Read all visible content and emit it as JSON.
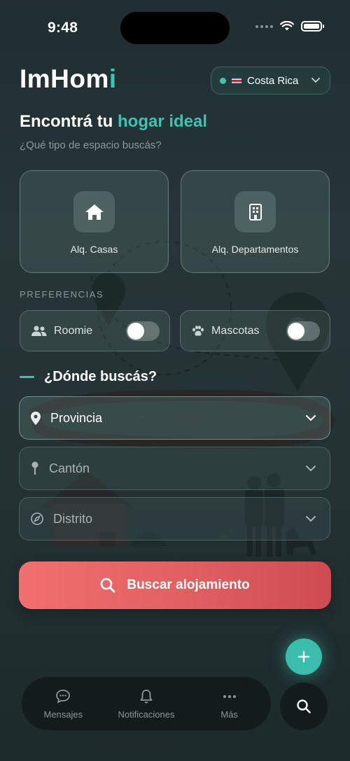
{
  "status_bar": {
    "time": "9:48"
  },
  "app": {
    "logo_main": "ImHom",
    "logo_accent": "i"
  },
  "country": {
    "name": "Costa Rica",
    "flag": "cr-flag"
  },
  "headline": {
    "prefix": "Encontrá tu ",
    "highlight": "hogar ideal"
  },
  "subheadline": "¿Qué tipo de espacio buscás?",
  "space_types": [
    {
      "label": "Alq. Casas",
      "icon": "house-icon"
    },
    {
      "label": "Alq. Departamentos",
      "icon": "building-icon"
    }
  ],
  "preferences": {
    "title": "PREFERENCIAS",
    "items": [
      {
        "label": "Roomie",
        "icon": "people-icon",
        "enabled": false
      },
      {
        "label": "Mascotas",
        "icon": "paw-icon",
        "enabled": false
      }
    ]
  },
  "location": {
    "title": "¿Dónde buscás?",
    "fields": [
      {
        "label": "Provincia",
        "icon": "location-pin-icon"
      },
      {
        "label": "Cantón",
        "icon": "map-pin-icon"
      },
      {
        "label": "Distrito",
        "icon": "compass-icon"
      }
    ]
  },
  "search_button": "Buscar alojamiento",
  "tabbar": [
    {
      "label": "Mensajes",
      "icon": "chat-icon"
    },
    {
      "label": "Notificaciones",
      "icon": "bell-icon"
    },
    {
      "label": "Más",
      "icon": "more-icon"
    }
  ],
  "colors": {
    "accent": "#3ec2b1",
    "cta": "#e05f61",
    "background": "#243234"
  }
}
